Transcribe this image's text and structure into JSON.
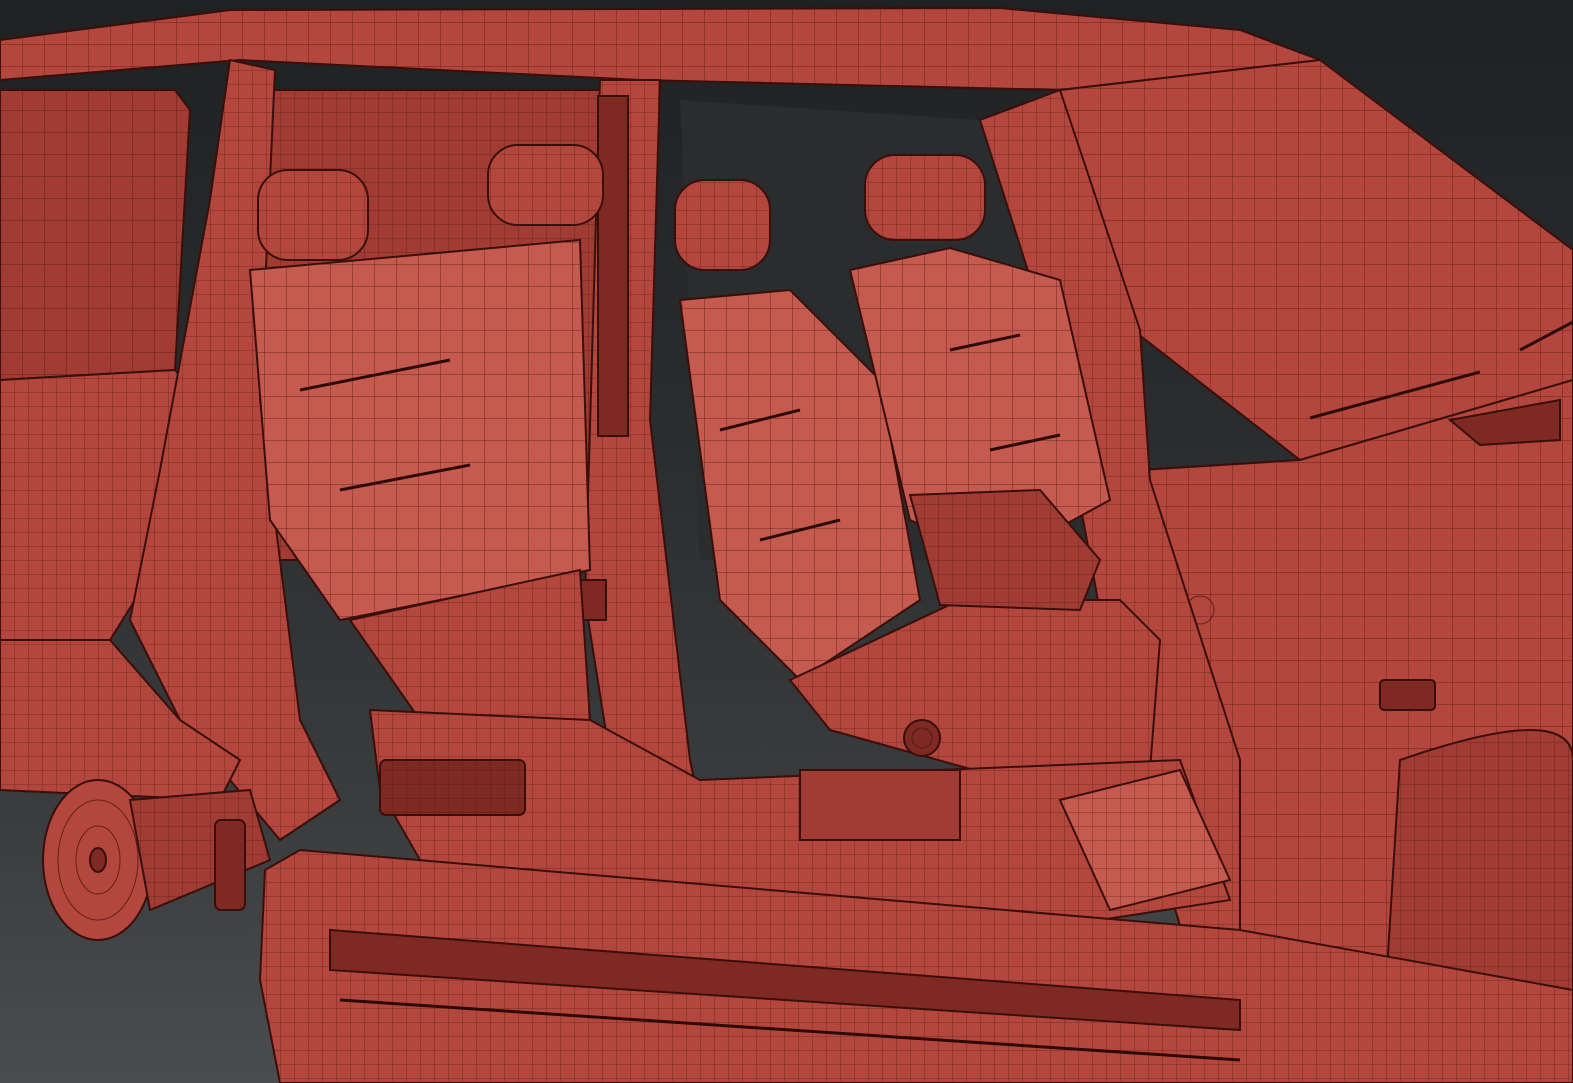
{
  "scene": {
    "colors": {
      "background_top": "#1f2123",
      "background_bottom": "#4a4c4e",
      "model_base": "#b4473d",
      "model_dark": "#7e2a22",
      "wireframe": "#3a0f0b"
    },
    "parts": [
      "roof",
      "windshield",
      "rear-window",
      "b-pillar",
      "rear-seat",
      "front-seat-driver",
      "front-seat-passenger",
      "center-console",
      "rear-wheel-hub",
      "side-step",
      "front-fender",
      "hood"
    ]
  }
}
